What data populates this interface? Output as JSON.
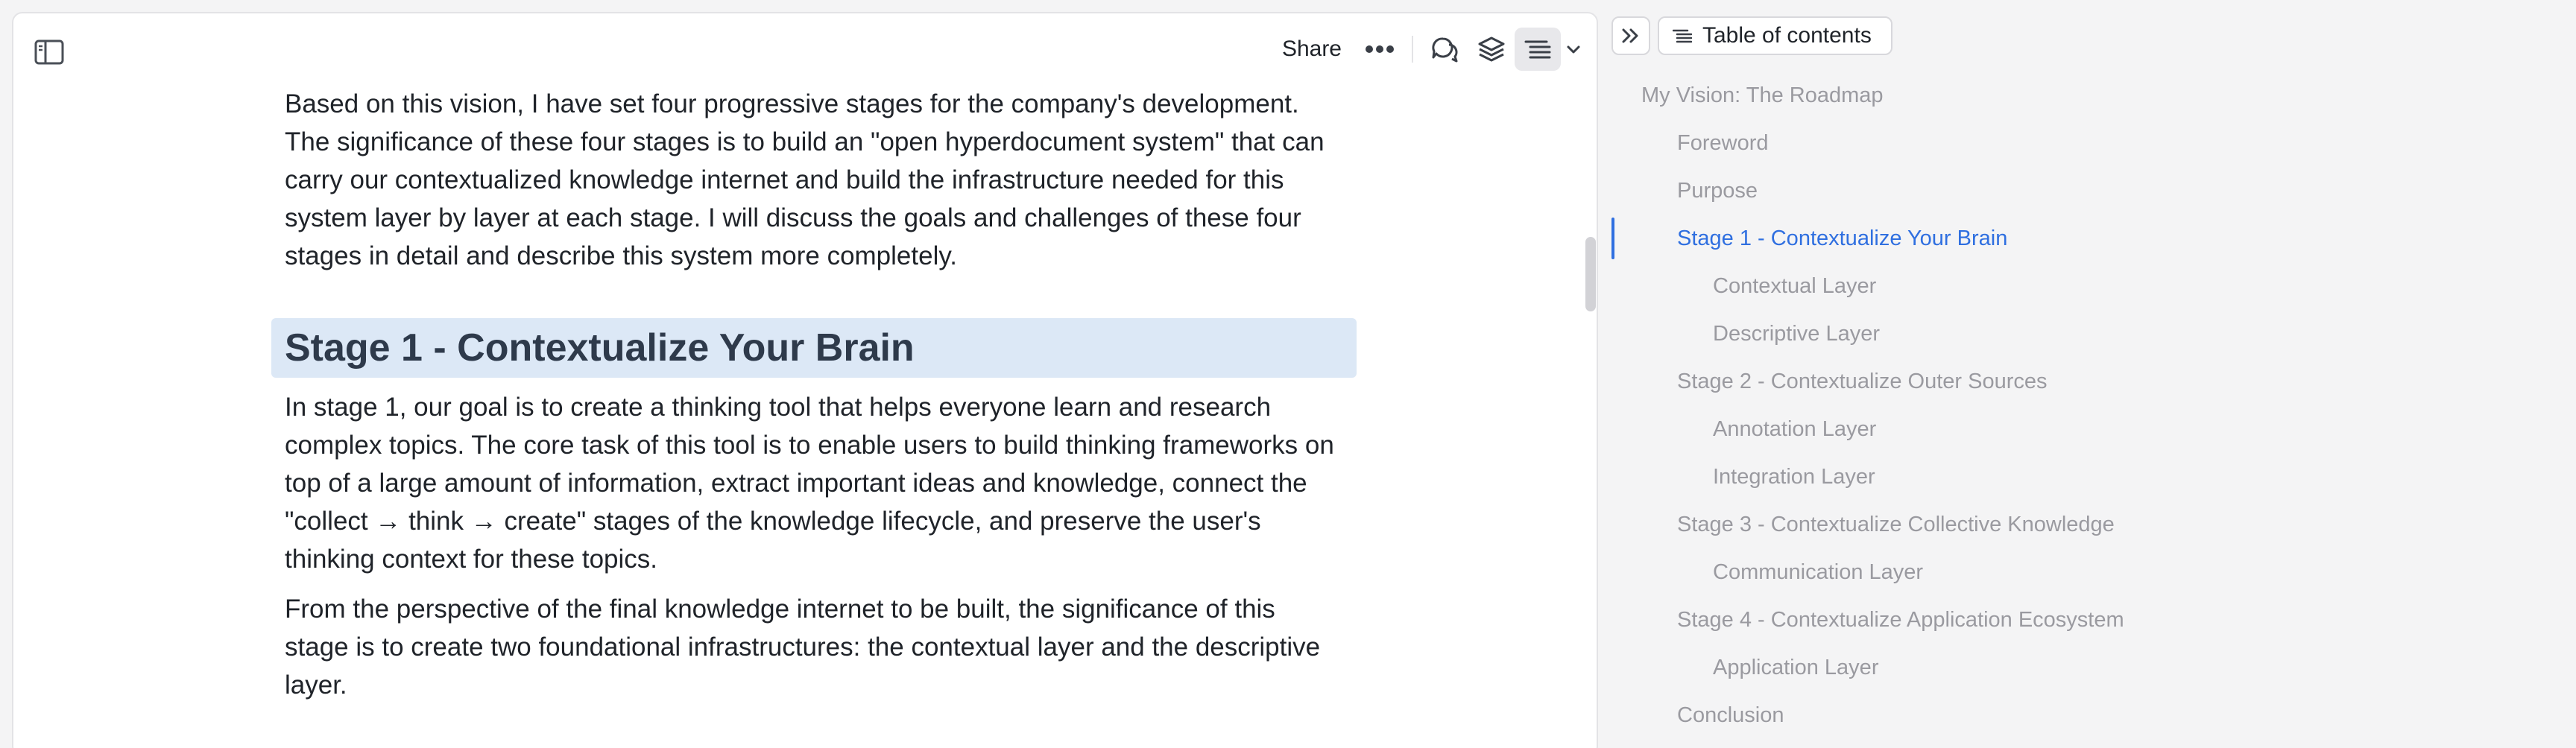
{
  "toolbar": {
    "share_label": "Share"
  },
  "document": {
    "paragraph_intro": "Based on this vision, I have set four progressive stages for the company's development. The significance of these four stages is to build an \"open hyperdocument system\" that can carry our contextualized knowledge internet and build the infrastructure needed for this system layer by layer at each stage. I will discuss the goals and challenges of these four stages in detail and describe this system more completely.",
    "heading_stage1": "Stage 1 - Contextualize Your Brain",
    "paragraph_stage1_a": "In stage 1, our goal is to create a thinking tool that helps everyone learn and research complex topics. The core task of this tool is to enable users to build thinking frameworks on top of a large amount of information, extract important ideas and knowledge, connect the \"collect → think → create\" stages of the knowledge lifecycle, and preserve the user's thinking context for these topics.",
    "paragraph_stage1_b": "From the perspective of the final knowledge internet to be built, the significance of this stage is to create two foundational infrastructures: the contextual layer and the descriptive layer."
  },
  "toc": {
    "title": "Table of contents",
    "items": [
      {
        "label": "My Vision: The Roadmap",
        "level": 0,
        "active": false
      },
      {
        "label": "Foreword",
        "level": 1,
        "active": false
      },
      {
        "label": "Purpose",
        "level": 1,
        "active": false
      },
      {
        "label": "Stage 1 - Contextualize Your Brain",
        "level": 1,
        "active": true
      },
      {
        "label": "Contextual Layer",
        "level": 2,
        "active": false
      },
      {
        "label": "Descriptive Layer",
        "level": 2,
        "active": false
      },
      {
        "label": "Stage 2 - Contextualize Outer Sources",
        "level": 1,
        "active": false
      },
      {
        "label": "Annotation Layer",
        "level": 2,
        "active": false
      },
      {
        "label": "Integration Layer",
        "level": 2,
        "active": false
      },
      {
        "label": "Stage 3 - Contextualize Collective Knowledge",
        "level": 1,
        "active": false
      },
      {
        "label": "Communication Layer",
        "level": 2,
        "active": false
      },
      {
        "label": "Stage 4 - Contextualize Application Ecosystem",
        "level": 1,
        "active": false
      },
      {
        "label": "Application Layer",
        "level": 2,
        "active": false
      },
      {
        "label": "Conclusion",
        "level": 1,
        "active": false
      }
    ]
  },
  "icons": {
    "sidebar_toggle": "sidebar-toggle-icon",
    "more": "more-dots-icon",
    "comments": "chat-bubbles-icon",
    "layers": "layers-icon",
    "toc": "list-icon",
    "chevron": "chevron-down-icon",
    "collapse_toc": "double-chevron-right-icon"
  },
  "colors": {
    "accent": "#2f6fe0",
    "heading_highlight": "#dce8f6",
    "toc_inactive": "#9a9aa0"
  }
}
